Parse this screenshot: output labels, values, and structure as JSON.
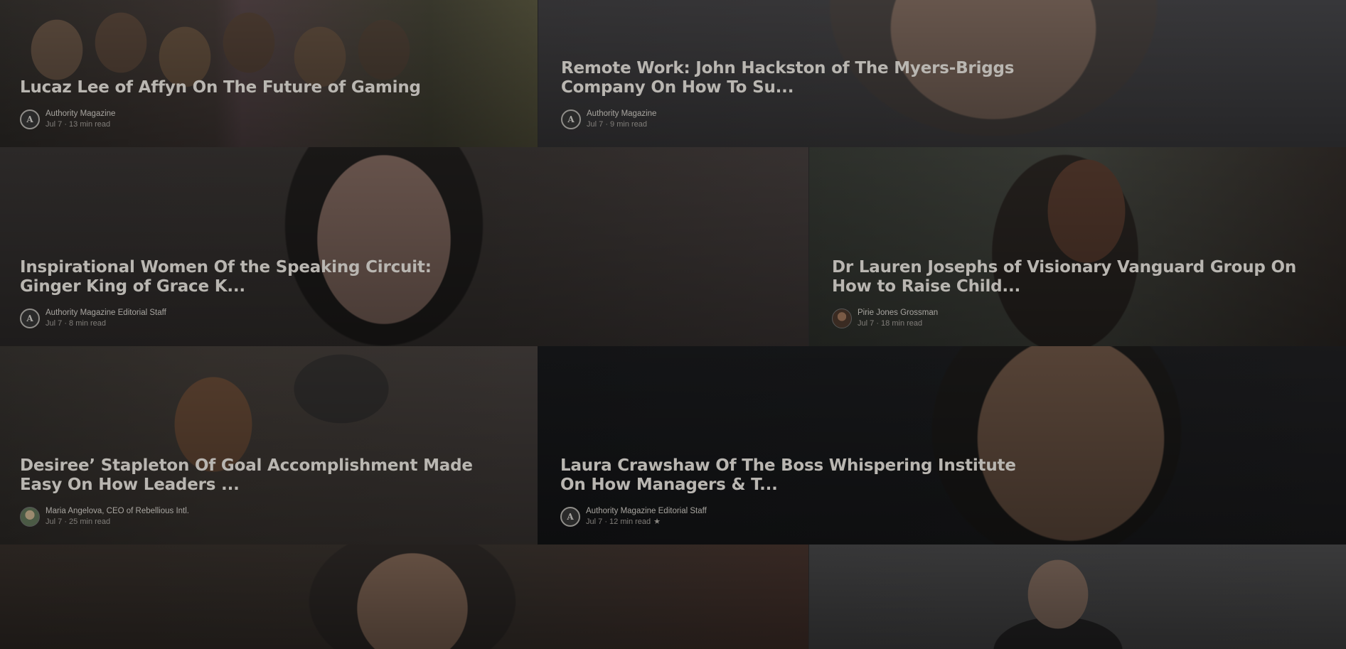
{
  "cards": [
    {
      "title": "Lucaz Lee of Affyn On The Future of Gaming",
      "author": "Authority Magazine",
      "date": "Jul 7",
      "read_time": "13 min read",
      "avatar": "authority-magazine-logo"
    },
    {
      "title": "Remote Work: John Hackston of The Myers-Briggs Company On How To Su...",
      "author": "Authority Magazine",
      "date": "Jul 7",
      "read_time": "9 min read",
      "avatar": "authority-magazine-logo"
    },
    {
      "title": "Inspirational Women Of the Speaking Circuit: Ginger King of Grace K...",
      "author": "Authority Magazine Editorial Staff",
      "date": "Jul 7",
      "read_time": "8 min read",
      "avatar": "authority-magazine-logo"
    },
    {
      "title": "Dr Lauren Josephs of Visionary Vanguard Group On How to Raise Child...",
      "author": "Pirie Jones Grossman",
      "date": "Jul 7",
      "read_time": "18 min read",
      "avatar": "author-photo"
    },
    {
      "title": "Desiree’ Stapleton Of Goal Accomplishment Made Easy On How Leaders ...",
      "author": "Maria Angelova, CEO of Rebellious Intl.",
      "date": "Jul 7",
      "read_time": "25 min read",
      "avatar": "author-photo"
    },
    {
      "title": "Laura Crawshaw Of The Boss Whispering Institute On How Managers & T...",
      "author": "Authority Magazine Editorial Staff",
      "date": "Jul 7",
      "read_time": "12 min read",
      "avatar": "authority-magazine-logo",
      "member_only": "★"
    }
  ],
  "separator": "·",
  "logo_letter": "A"
}
